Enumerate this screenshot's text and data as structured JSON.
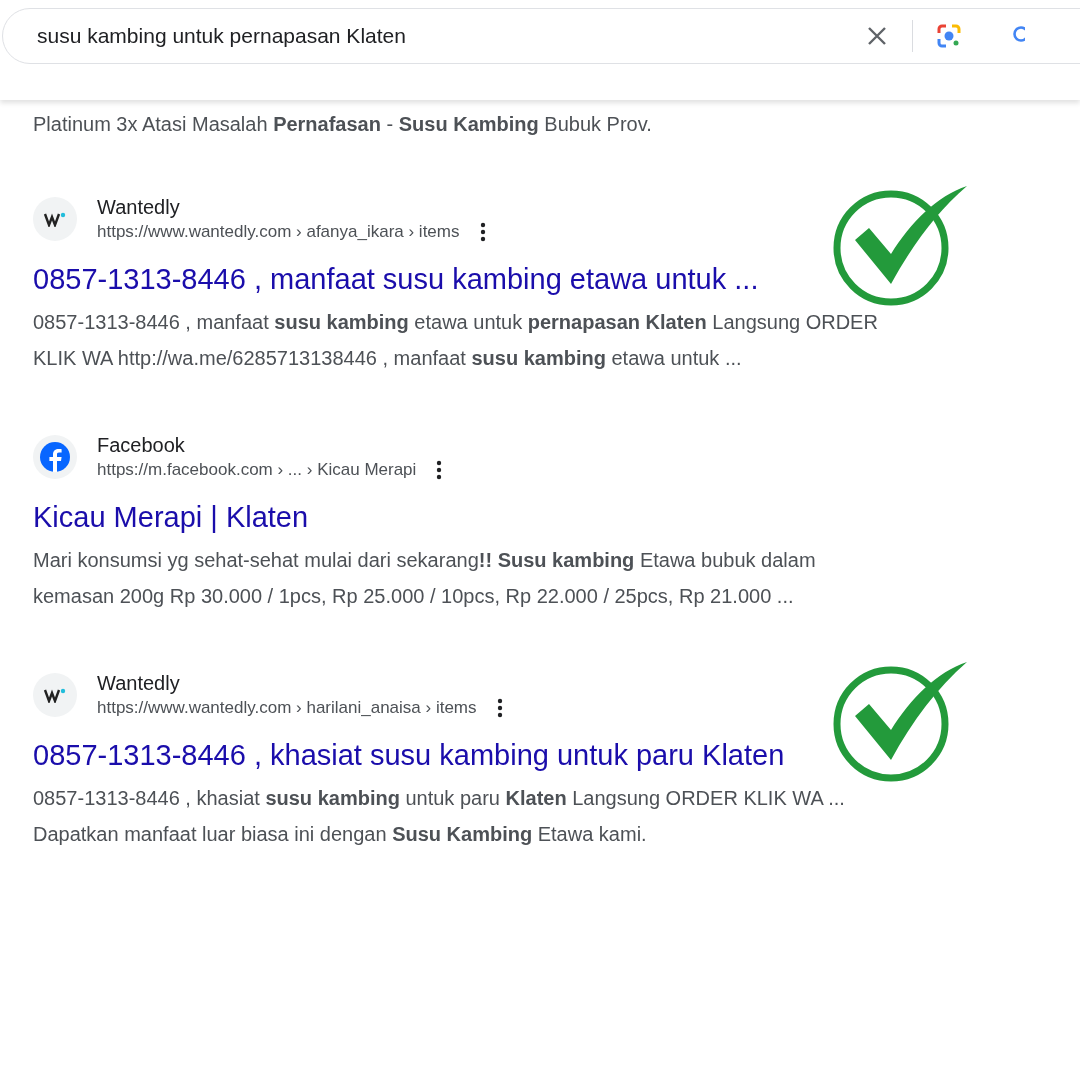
{
  "search": {
    "value": "susu kambing untuk pernapasan Klaten"
  },
  "partial_snippet": "Platinum 3x Atasi Masalah **Pernafasan** - **Susu Kambing** Bubuk Prov.",
  "results": [
    {
      "kind": "wantedly",
      "site": "Wantedly",
      "url": "https://www.wantedly.com › afanya_ikara › items",
      "title": "0857-1313-8446 , manfaat susu kambing etawa untuk ...",
      "snippet": [
        "0857-1313-8446 , manfaat **susu kambing** etawa untuk **pernapasan Klaten** Langsung ORDER",
        "KLIK WA http://wa.me/6285713138446 , manfaat **susu kambing** etawa untuk ..."
      ],
      "verified": true
    },
    {
      "kind": "facebook",
      "site": "Facebook",
      "url": "https://m.facebook.com › ... › Kicau Merapi",
      "title": "Kicau Merapi | Klaten",
      "snippet": [
        "Mari konsumsi yg sehat-sehat mulai dari sekarang**!! Susu kambing** Etawa bubuk dalam",
        "kemasan 200g Rp 30.000 / 1pcs, Rp 25.000 / 10pcs, Rp 22.000 / 25pcs, Rp 21.000 ..."
      ],
      "verified": false
    },
    {
      "kind": "wantedly",
      "site": "Wantedly",
      "url": "https://www.wantedly.com › harilani_anaisa › items",
      "title": "0857-1313-8446 , khasiat susu kambing untuk paru Klaten",
      "snippet": [
        "0857-1313-8446 , khasiat **susu kambing** untuk paru **Klaten** Langsung ORDER KLIK WA ...",
        "Dapatkan manfaat luar biasa ini dengan **Susu Kambing** Etawa kami."
      ],
      "verified": true
    }
  ]
}
